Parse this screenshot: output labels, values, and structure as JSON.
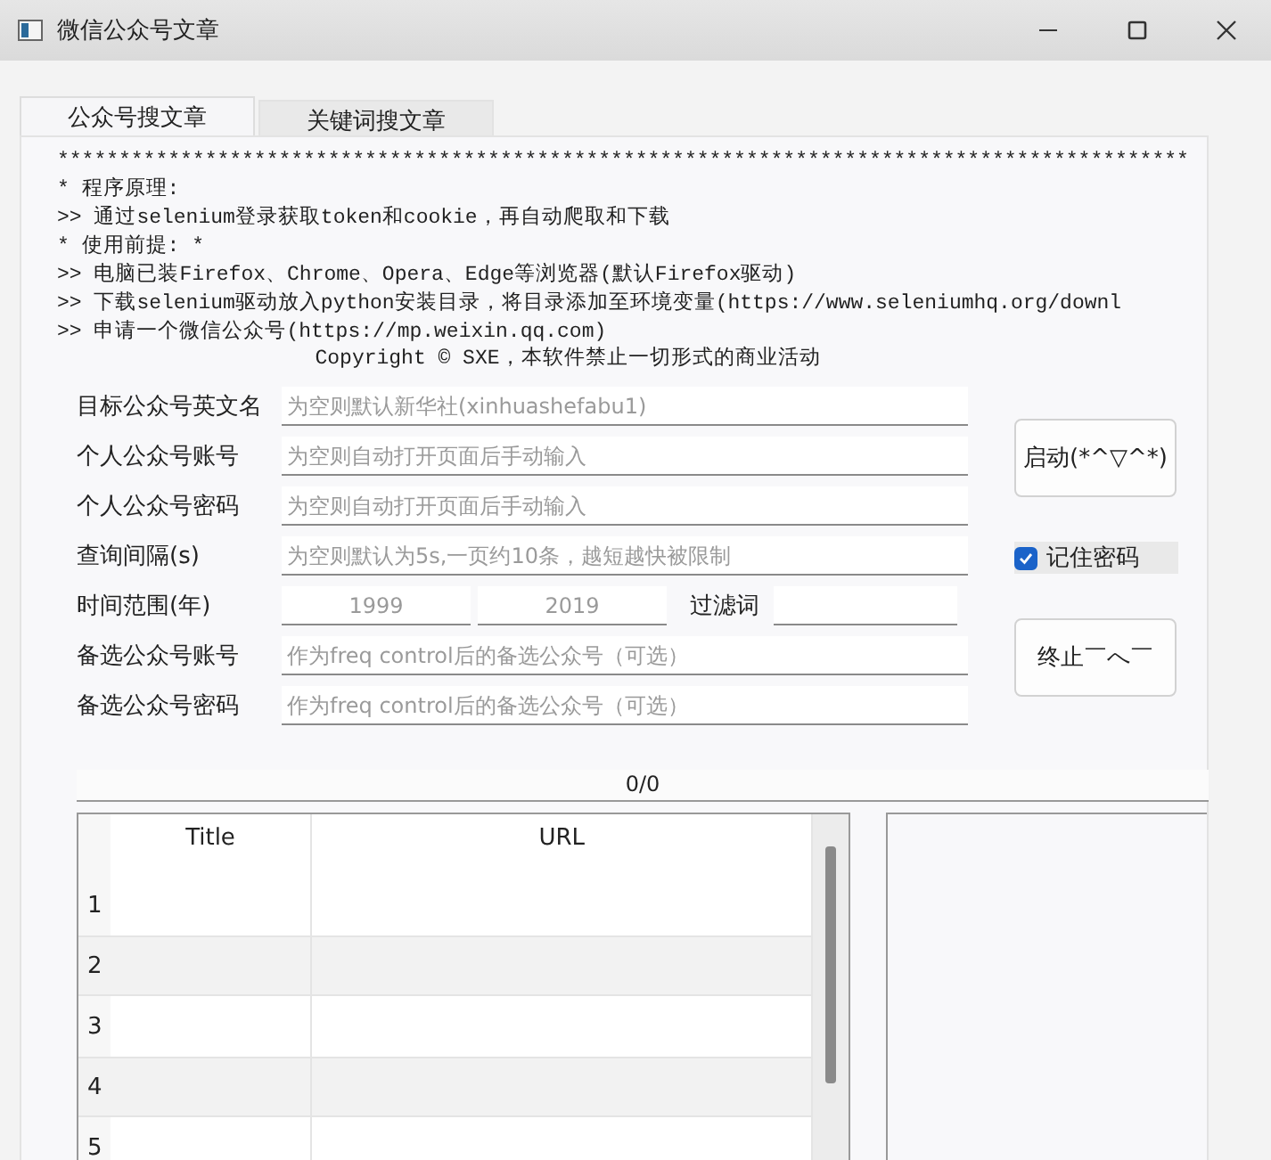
{
  "window": {
    "title": "微信公众号文章"
  },
  "tabs": [
    {
      "label": "公众号搜文章",
      "selected": true
    },
    {
      "label": "关键词搜文章",
      "selected": false
    }
  ],
  "info_text": {
    "lines": [
      "********************************************************************************************",
      "* 程序原理:",
      ">> 通过selenium登录获取token和cookie，再自动爬取和下载",
      "* 使用前提: *",
      ">> 电脑已装Firefox、Chrome、Opera、Edge等浏览器(默认Firefox驱动)",
      ">> 下载selenium驱动放入python安装目录，将目录添加至环境变量(https://www.seleniumhq.org/downl",
      ">> 申请一个微信公众号(https://mp.weixin.qq.com)"
    ],
    "copyright": "Copyright © SXE，本软件禁止一切形式的商业活动"
  },
  "form": {
    "fields": [
      {
        "kind": "text",
        "label": "目标公众号英文名",
        "placeholder": "为空则默认新华社(xinhuashefabu1)"
      },
      {
        "kind": "text",
        "label": "个人公众号账号",
        "placeholder": "为空则自动打开页面后手动输入"
      },
      {
        "kind": "text",
        "label": "个人公众号密码",
        "placeholder": "为空则自动打开页面后手动输入"
      },
      {
        "kind": "text",
        "label": "查询间隔(s)",
        "placeholder": "为空则默认为5s,一页约10条，越短越快被限制"
      },
      {
        "kind": "range",
        "label": "时间范围(年)",
        "from_placeholder": "1999",
        "to_placeholder": "2019",
        "filter_label": "过滤词"
      },
      {
        "kind": "text",
        "label": "备选公众号账号",
        "placeholder": "作为freq control后的备选公众号（可选）"
      },
      {
        "kind": "text",
        "label": "备选公众号密码",
        "placeholder": "作为freq control后的备选公众号（可选）"
      }
    ],
    "start_button": "启动(*^▽^*)",
    "remember_password": {
      "label": "记住密码",
      "checked": true
    },
    "stop_button": "终止￣へ￣"
  },
  "progress": {
    "text": "0/0",
    "level": 0
  },
  "table": {
    "columns": [
      "Title",
      "URL"
    ],
    "rows": [
      {
        "number": "1"
      },
      {
        "number": "2"
      },
      {
        "number": "3"
      },
      {
        "number": "4"
      },
      {
        "number": "5"
      }
    ]
  }
}
